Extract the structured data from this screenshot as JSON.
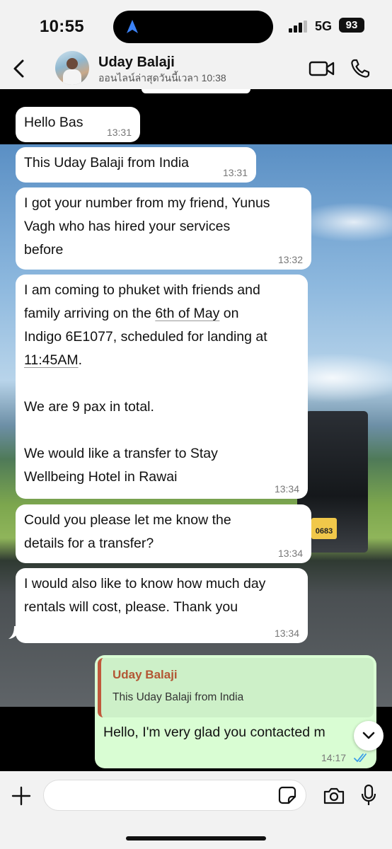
{
  "status_bar": {
    "time": "10:55",
    "network": "5G",
    "battery": "93"
  },
  "header": {
    "contact_name": "Uday Balaji",
    "contact_status": "ออนไลน์ล่าสุดวันนี้เวลา 10:38"
  },
  "messages": [
    {
      "text": "Hello Bas",
      "time": "13:31"
    },
    {
      "text": "This Uday Balaji from India",
      "time": "13:31"
    },
    {
      "text": "I got your number from my friend, Yunus\nVagh who has hired your services\nbefore",
      "time": "13:32"
    },
    {
      "parts": [
        "I am coming to phuket with friends and\nfamily arriving on the ",
        "6th of May",
        " on\nIndigo 6E1077, scheduled for landing at\n",
        "11:45AM",
        ".\n\nWe are 9 pax in total.\n\nWe would like a transfer to Stay\nWellbeing Hotel in Rawai"
      ],
      "time": "13:34"
    },
    {
      "text": "Could you please let me know the\ndetails for a transfer?",
      "time": "13:34"
    },
    {
      "text": "I would also like to know how much day\nrentals will cost, please. Thank you",
      "time": "13:34"
    }
  ],
  "outgoing": {
    "quote_name": "Uday Balaji",
    "quote_text": "This Uday Balaji from India",
    "text": "Hello, I'm very glad you contacted m",
    "time": "14:17"
  },
  "wallpaper_plate": "0683",
  "colors": {
    "accent": "#c0583b",
    "outgoing_bg": "#d9fdd3",
    "read_ticks": "#3a9de8"
  }
}
